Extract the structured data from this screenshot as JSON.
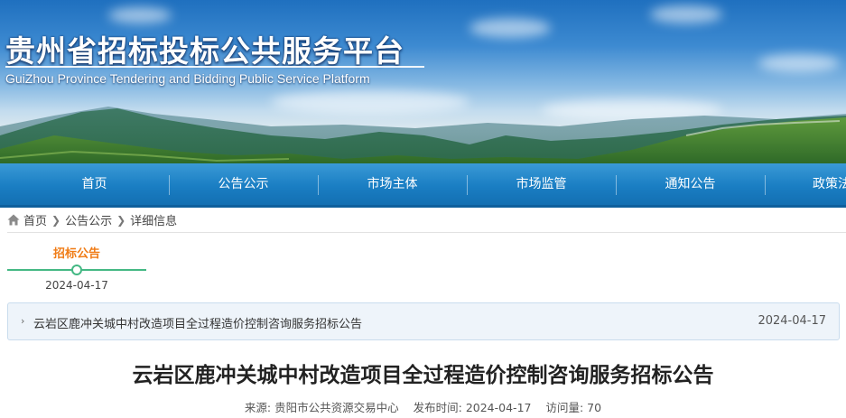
{
  "header": {
    "title": "贵州省招标投标公共服务平台",
    "subtitle": "GuiZhou Province Tendering and Bidding Public Service Platform"
  },
  "nav": {
    "items": [
      {
        "label": "首页"
      },
      {
        "label": "公告公示"
      },
      {
        "label": "市场主体"
      },
      {
        "label": "市场监管"
      },
      {
        "label": "通知公告"
      },
      {
        "label": "政策法"
      }
    ]
  },
  "breadcrumb": {
    "home": "首页",
    "section": "公告公示",
    "current": "详细信息",
    "home_icon": "home-icon",
    "separator_icon": "chevron-right-icon"
  },
  "timeline": {
    "label": "招标公告",
    "date": "2024-04-17",
    "accent_color": "#f07c16",
    "line_color": "#44b884"
  },
  "notice_list": {
    "items": [
      {
        "title": "云岩区鹿冲关城中村改造项目全过程造价控制咨询服务招标公告",
        "date": "2024-04-17"
      }
    ]
  },
  "article": {
    "title": "云岩区鹿冲关城中村改造项目全过程造价控制咨询服务招标公告",
    "source_label": "来源:",
    "source": "贵阳市公共资源交易中心",
    "publish_label": "发布时间:",
    "publish_date": "2024-04-17",
    "views_label": "访问量:",
    "views": "70"
  },
  "colors": {
    "nav_blue": "#1a7ec3",
    "title_text": "#222222"
  }
}
